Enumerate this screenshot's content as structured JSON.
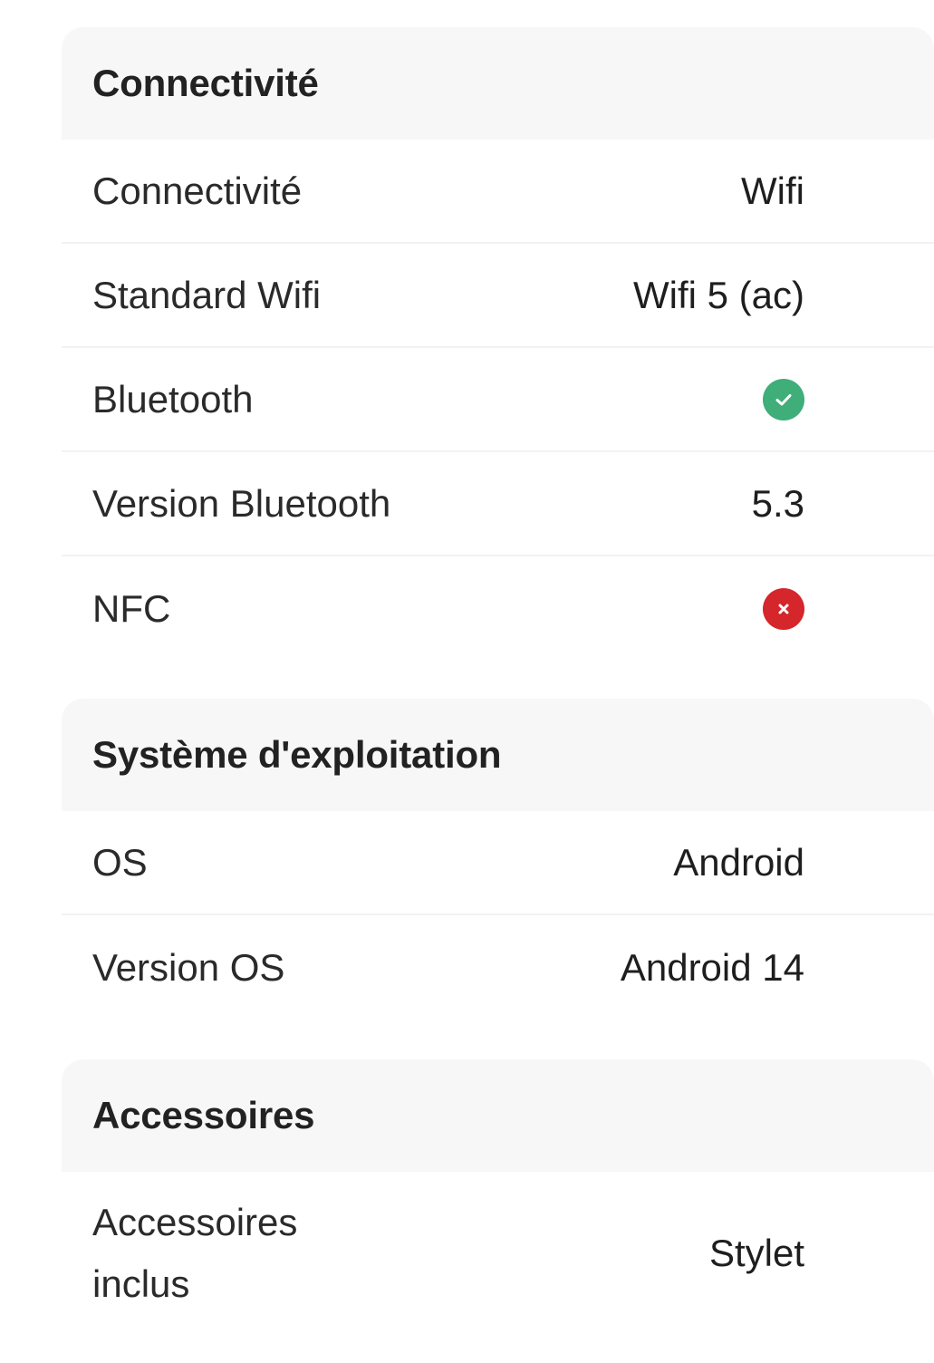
{
  "sections": [
    {
      "title": "Connectivité",
      "rows": [
        {
          "label": "Connectivité",
          "value": "Wifi"
        },
        {
          "label": "Standard Wifi",
          "value": "Wifi 5 (ac)"
        },
        {
          "label": "Bluetooth",
          "status": "yes",
          "icon": "check-circle-icon"
        },
        {
          "label": "Version Bluetooth",
          "value": "5.3"
        },
        {
          "label": "NFC",
          "status": "no",
          "icon": "cross-circle-icon"
        }
      ]
    },
    {
      "title": "Système d'exploitation",
      "rows": [
        {
          "label": "OS",
          "value": "Android"
        },
        {
          "label": "Version OS",
          "value": "Android 14"
        }
      ]
    },
    {
      "title": "Accessoires",
      "rows": [
        {
          "label": "Accessoires inclus",
          "value": "Stylet"
        }
      ]
    }
  ],
  "colors": {
    "header_bg": "#f7f7f7",
    "yes": "#3fae78",
    "no": "#d4262b"
  }
}
